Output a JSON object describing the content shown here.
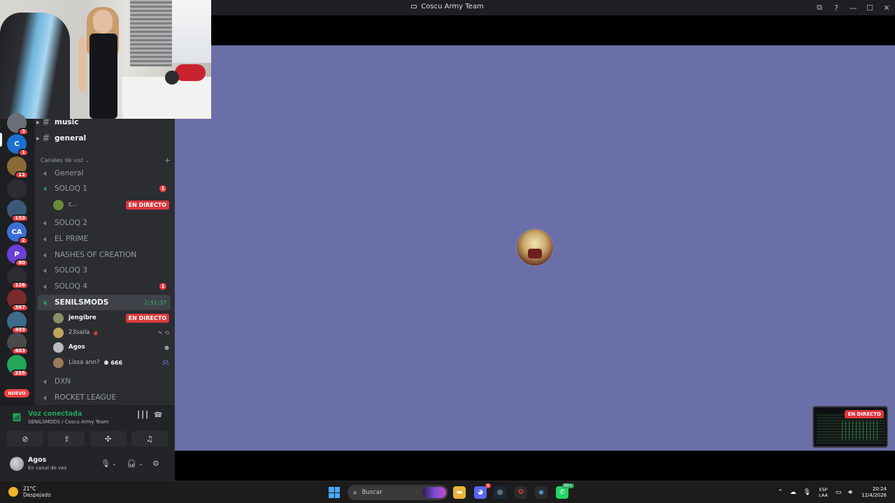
{
  "window": {
    "title": "Coscu Army Team",
    "controls": [
      "⧉",
      "?",
      "—",
      "☐",
      "✕"
    ]
  },
  "servers": [
    {
      "badge": "3",
      "color": "#6d6f78",
      "label": ""
    },
    {
      "badge": "1",
      "color": "#1e6fd1",
      "label": "C"
    },
    {
      "badge": "11",
      "color": "#8a6a35",
      "label": ""
    },
    {
      "badge": "",
      "color": "#2b2d31",
      "label": ""
    },
    {
      "badge": "153",
      "color": "#3a5a78",
      "label": ""
    },
    {
      "badge": "2",
      "color": "#3b6fd8",
      "label": "CA"
    },
    {
      "badge": "80",
      "color": "#6a3fd8",
      "label": "P"
    },
    {
      "badge": "126",
      "color": "#2b2d31",
      "label": ""
    },
    {
      "badge": "367",
      "color": "#7a2b2b",
      "label": ""
    },
    {
      "badge": "493",
      "color": "#3d6b8a",
      "label": ""
    },
    {
      "badge": "403",
      "color": "#4a4a4a",
      "label": ""
    },
    {
      "badge": "255",
      "color": "#23a55a",
      "label": ""
    }
  ],
  "server_new_label": "NUEVO",
  "channels": {
    "text": [
      {
        "name": "music"
      },
      {
        "name": "general"
      }
    ],
    "voice_category": "Canales de voz",
    "voice": [
      {
        "name": "General",
        "badge": ""
      },
      {
        "name": "SOLOQ 1",
        "badge": "1"
      },
      {
        "name": "SOLOQ 2",
        "badge": ""
      },
      {
        "name": "EL PRIME",
        "badge": ""
      },
      {
        "name": "NASHES OF CREATION",
        "badge": ""
      },
      {
        "name": "SOLOQ 3",
        "badge": ""
      },
      {
        "name": "SOLOQ 4",
        "badge": "1"
      },
      {
        "name": "SENILSMODS",
        "timer": "2:51:57"
      },
      {
        "name": "DXN",
        "badge": ""
      },
      {
        "name": "ROCKET LEAGUE",
        "badge": ""
      }
    ],
    "soloq1_user": {
      "name": "c...",
      "live": "EN DIRECTO"
    },
    "senil_users": [
      {
        "name": "jengibre",
        "live": "EN DIRECTO"
      },
      {
        "name": "23saila",
        "status": "✎ ⟲"
      },
      {
        "name": "Agos",
        "status": "●"
      },
      {
        "name": "Lissa ann?",
        "extra": "666"
      }
    ]
  },
  "voice_panel": {
    "status": "Voz conectada",
    "location": "SENILSMODS / Coscu Army Team"
  },
  "user_panel": {
    "name": "Agos",
    "status": "En canal de voz"
  },
  "stream": {
    "live_label": "EN DIRECTO"
  },
  "taskbar": {
    "weather_temp": "21°C",
    "weather_desc": "Despejado",
    "search_placeholder": "Buscar",
    "lang_line1": "ESP",
    "lang_line2": "LAA",
    "time": "20:24",
    "date": "12/4/2026",
    "discord_badge": "9",
    "whatsapp_badge": "99+"
  }
}
